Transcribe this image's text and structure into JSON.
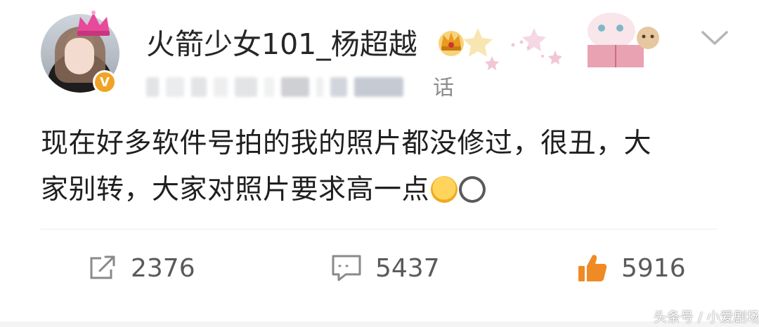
{
  "post": {
    "username": "火箭少女101_杨超越",
    "meta_suffix": "话",
    "text_line1": "现在好多软件号拍的我的照片都没修过，很丑，大",
    "text_line2": "家别转，大家对照片要求高一点",
    "verified_mark": "V"
  },
  "actions": {
    "forward_count": "2376",
    "comment_count": "5437",
    "like_count": "5916"
  },
  "watermark": "头条号 / 小爱剧场",
  "colors": {
    "like_orange": "#f08a24",
    "verified_gold": "#f1a325",
    "icon_gray": "#8a8a8a"
  }
}
